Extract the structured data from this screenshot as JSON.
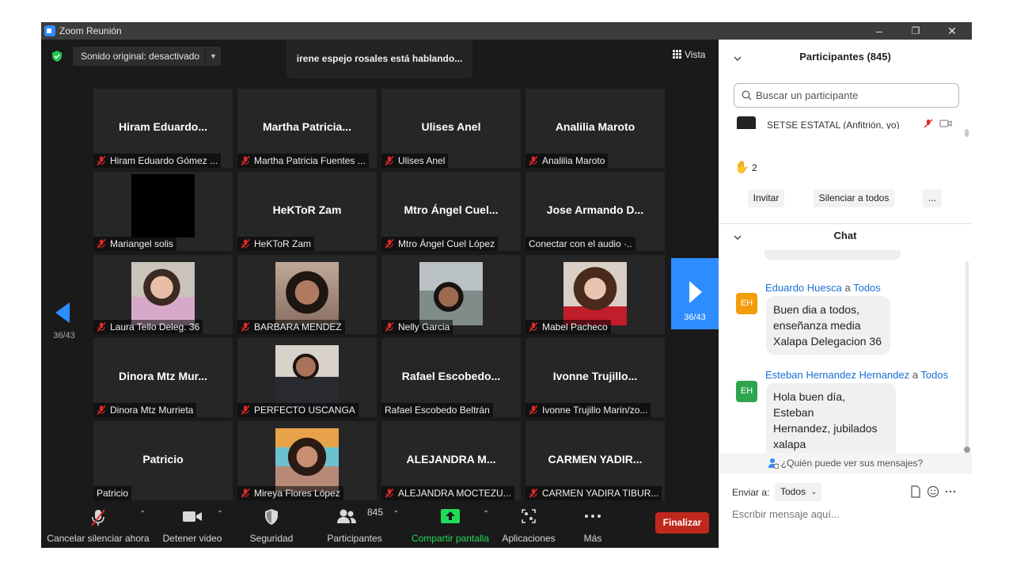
{
  "window": {
    "title": "Zoom Reunión",
    "controls": {
      "minimize": "–",
      "restore": "❐",
      "close": "✕"
    }
  },
  "meeting": {
    "sound_button": "Sonido original: desactivado",
    "speaking_banner": "irene espejo rosales está hablando...",
    "view_label": "Vista",
    "page_left": "36/43",
    "page_right": "36/43"
  },
  "tiles": [
    {
      "big": "Hiram  Eduardo...",
      "label": "Hiram Eduardo Gómez ...",
      "muted": true,
      "photo": null
    },
    {
      "big": "Martha  Patricia...",
      "label": "Martha Patricia Fuentes ...",
      "muted": true,
      "photo": null
    },
    {
      "big": "Ulises Anel",
      "label": "Ulises Anel",
      "muted": true,
      "photo": null
    },
    {
      "big": "Analilia Maroto",
      "label": "Analilia Maroto",
      "muted": true,
      "photo": null
    },
    {
      "big": "",
      "label": "Mariangel solis",
      "muted": true,
      "photo": "black"
    },
    {
      "big": "HeKToR Zam",
      "label": "HeKToR Zam",
      "muted": true,
      "photo": null
    },
    {
      "big": "Mtro Ángel Cuel...",
      "label": "Mtro Ángel Cuel López",
      "muted": true,
      "photo": null
    },
    {
      "big": "Jose Armando D...",
      "label": "Conectar con el audio ·..",
      "muted": false,
      "photo": null
    },
    {
      "big": "",
      "label": "Laura Tello Deleg. 36",
      "muted": true,
      "photo": "laura"
    },
    {
      "big": "",
      "label": "BARBARA MENDEZ",
      "muted": true,
      "photo": "barbara"
    },
    {
      "big": "",
      "label": "Nelly Garcia",
      "muted": true,
      "photo": "nelly"
    },
    {
      "big": "",
      "label": "Mabel Pacheco",
      "muted": true,
      "photo": "mabel"
    },
    {
      "big": "Dinora Mtz Mur...",
      "label": "Dinora Mtz Murrieta",
      "muted": true,
      "photo": null
    },
    {
      "big": "",
      "label": "PERFECTO USCANGA",
      "muted": true,
      "photo": "perfecto"
    },
    {
      "big": "Rafael  Escobedo...",
      "label": "Rafael Escobedo Beltrán",
      "muted": false,
      "photo": null
    },
    {
      "big": "Ivonne  Trujillo...",
      "label": "Ivonne Trujillo Marin/zo...",
      "muted": true,
      "photo": null
    },
    {
      "big": "Patricio",
      "label": "Patricio",
      "muted": false,
      "photo": null
    },
    {
      "big": "",
      "label": "Mireya Flores López",
      "muted": true,
      "photo": "mireya"
    },
    {
      "big": "ALEJANDRA M...",
      "label": "ALEJANDRA MOCTEZU...",
      "muted": true,
      "photo": null
    },
    {
      "big": "CARMEN  YADIR...",
      "label": "CARMEN YADIRA TIBUR...",
      "muted": true,
      "photo": null
    }
  ],
  "toolbar": {
    "unmute": "Cancelar silenciar ahora",
    "video": "Detener video",
    "security": "Seguridad",
    "participants": "Participantes",
    "participants_count": "845",
    "share": "Compartir pantalla",
    "apps": "Aplicaciones",
    "more": "Más",
    "end": "Finalizar"
  },
  "participants_panel": {
    "title": "Participantes (845)",
    "search_placeholder": "Buscar un participante",
    "first_row": "SETSE ESTATAL (Anfitrión, yo)",
    "hands_count": "2",
    "invite": "Invitar",
    "mute_all": "Silenciar a todos",
    "more": "..."
  },
  "chat": {
    "title": "Chat",
    "messages": [
      {
        "sender": "Eduardo Huesca",
        "connector": "a",
        "to": "Todos",
        "initials": "EH",
        "avatar_color": "#f29d0a",
        "lines": [
          "Buen dia a todos,",
          "enseñanza media",
          "Xalapa Delegacion 36"
        ]
      },
      {
        "sender": "Esteban Hernandez Hernandez",
        "connector": "a",
        "to": "Todos",
        "initials": "EH",
        "avatar_color": "#2ea44f",
        "lines": [
          "Hola buen día, Esteban",
          "Hernandez, jubilados",
          "xalapa"
        ]
      }
    ],
    "who_can_see": "¿Quién puede ver sus mensajes?",
    "send_to_label": "Enviar a:",
    "send_to_value": "Todos",
    "input_placeholder": "Escribir mensaje aquí..."
  },
  "colors": {
    "accent_blue": "#2d8cff",
    "end_red": "#c0281e",
    "share_green": "#23d959",
    "mic_off_red": "#e02828"
  }
}
